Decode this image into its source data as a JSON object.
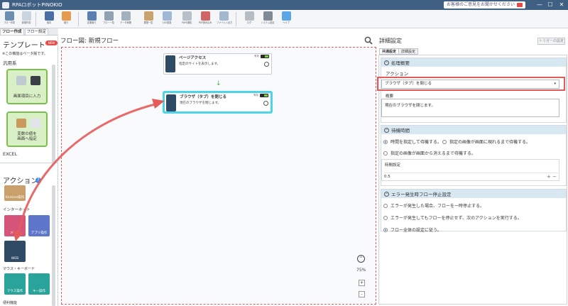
{
  "titlebar": {
    "title": "RPAロボットPINOKIO",
    "inquiry": "お客様のご意見をお聞かせください",
    "minimize": "—",
    "maximize": "☐",
    "close": "✕"
  },
  "ribbon": [
    {
      "label": "フロー作成",
      "color": "#6b8eb1"
    },
    {
      "label": "新規作成",
      "color": "#c9d4df"
    },
    {
      "label": "保存",
      "color": "#4a6fa5"
    },
    {
      "label": "実行",
      "color": "#e69a4d"
    },
    {
      "label": "定期実行",
      "color": "#5a7fb0"
    },
    {
      "label": "フロー一覧",
      "color": "#8fa1b3"
    },
    {
      "label": "データ管理",
      "color": "#a3b1bf"
    },
    {
      "label": "履歴一覧",
      "color": "#c9a36b"
    },
    {
      "label": "CSV変換",
      "color": "#9fb8d6"
    },
    {
      "label": "PAYE通知",
      "color": "#b7bfc8"
    },
    {
      "label": "PDF読み込み",
      "color": "#d06565"
    },
    {
      "label": "ファイル入出力",
      "color": "#a3b8cf"
    },
    {
      "label": "ログ",
      "color": "#b5bcc4"
    },
    {
      "label": "システム設定",
      "color": "#7f8a96"
    },
    {
      "label": "ヘルプ",
      "color": "#5aa6e6"
    }
  ],
  "left_tabs": [
    "フロー作成",
    "フロー設定"
  ],
  "left": {
    "template_title": "テンプレート",
    "beta_badge": "NEW",
    "beta_note": "※この機能はベータ版です。",
    "general_label": "汎用系",
    "tile1": "画面項目に入力",
    "tile2_line1": "変数の値を",
    "tile2_line2": "画面へ指定",
    "excel_label": "EXCEL",
    "action_title": "アクション",
    "help": "?",
    "kintone": "Kintone操作",
    "internet_label": "インターネット",
    "mail": "メール",
    "app": "アプリ操作",
    "web": "WEB",
    "mouse_kb_label": "マウス・キーボード",
    "mouse": "マウス操作",
    "key": "キー操作",
    "convenient_label": "便利機能"
  },
  "center": {
    "header": "フロー図:  新規フロー",
    "node1": {
      "title": "ページアクセス",
      "sub": "指定のサイトを表示します。",
      "flag": "有効"
    },
    "node2": {
      "title": "ブラウザ（タブ）を閉じる",
      "sub": "現在のブラウザを閉じます。",
      "flag": "有効"
    },
    "zoom_up": "^",
    "zoom": "75%",
    "zoom_in": "+",
    "zoom_out": "-"
  },
  "right": {
    "title": "詳細設定",
    "trigger": "トリガーの設定",
    "tabs": [
      "共通設定",
      "詳細設定"
    ],
    "sec1": "処理概要",
    "action_label": "アクション",
    "action_value": "ブラウザ（タブ）を閉じる",
    "caret": "▾",
    "summary_label": "概要",
    "summary_value": "現在のブラウザを閉じます。",
    "sec2": "待機時間",
    "wait1": "時間を指定して待機する。",
    "wait2": "指定の画像が画面に現れるまで待機する。",
    "wait3": "指定の画像が画面から消えるまで待機する。",
    "time_label": "時間設定",
    "time_value": "0.5",
    "spin": "+ −",
    "sec3": "エラー発生時フロー停止設定",
    "err1": "エラーが発生した場合、フローを一時停止する。",
    "err2": "エラーが発生してもフローを停止せず、次のアクションを実行する。",
    "err3": "フロー全体の設定に従う。",
    "collapse": "^"
  },
  "colors": {
    "accent": "#3f5f83",
    "highlight": "#e25a5a",
    "select_node": "#4fd3e6",
    "green": "#7dbf4b"
  }
}
